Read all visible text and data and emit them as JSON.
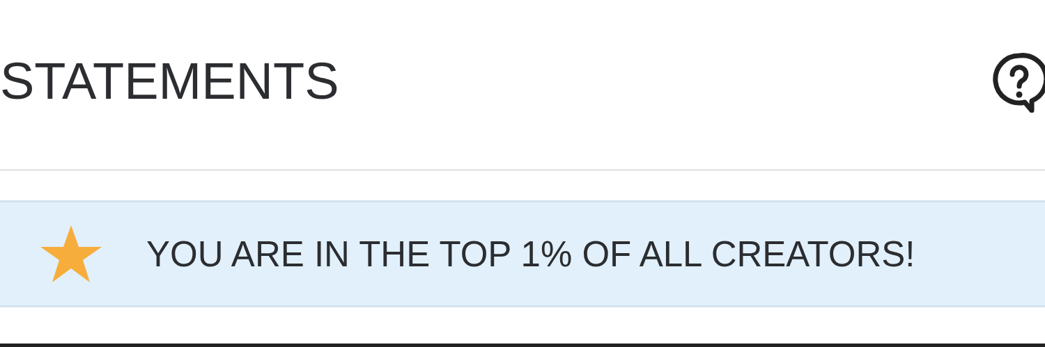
{
  "header": {
    "title": "STATEMENTS"
  },
  "banner": {
    "message": "YOU ARE IN THE TOP 1% OF ALL CREATORS!"
  }
}
